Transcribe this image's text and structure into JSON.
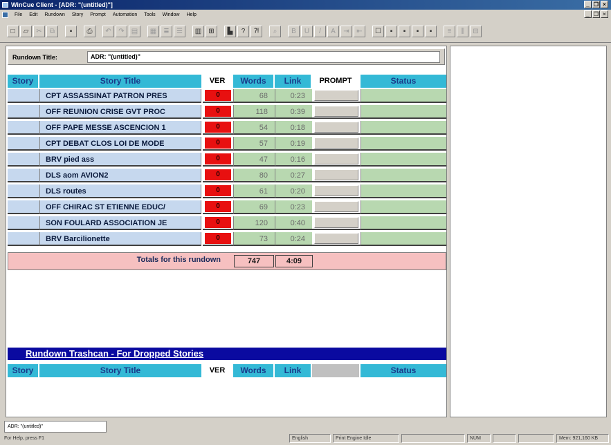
{
  "window": {
    "title": "WinCue Client - [ADR: \"(untitled)\"]"
  },
  "menu": [
    "File",
    "Edit",
    "Rundown",
    "Story",
    "Prompt",
    "Automation",
    "Tools",
    "Window",
    "Help"
  ],
  "rundown": {
    "title_label": "Rundown Title:",
    "title_value": "ADR: \"(untitled)\""
  },
  "columns": {
    "story": "Story",
    "title": "Story Title",
    "ver": "VER",
    "words": "Words",
    "link": "Link",
    "prompt": "PROMPT",
    "status": "Status"
  },
  "rows": [
    {
      "title": "CPT ASSASSINAT PATRON PRES",
      "ver": "0",
      "words": "68",
      "link": "0:23"
    },
    {
      "title": "OFF REUNION CRISE GVT PROC",
      "ver": "0",
      "words": "118",
      "link": "0:39"
    },
    {
      "title": "OFF PAPE MESSE ASCENCION 1",
      "ver": "0",
      "words": "54",
      "link": "0:18"
    },
    {
      "title": "CPT DEBAT CLOS LOI DE MODE",
      "ver": "0",
      "words": "57",
      "link": "0:19"
    },
    {
      "title": "BRV pied ass",
      "ver": "0",
      "words": "47",
      "link": "0:16"
    },
    {
      "title": "DLS aom        AVION2",
      "ver": "0",
      "words": "80",
      "link": "0:27"
    },
    {
      "title": "DLS routes",
      "ver": "0",
      "words": "61",
      "link": "0:20"
    },
    {
      "title": "OFF CHIRAC ST ETIENNE EDUC/",
      "ver": "0",
      "words": "69",
      "link": "0:23"
    },
    {
      "title": "SON FOULARD ASSOCIATION JE",
      "ver": "0",
      "words": "120",
      "link": "0:40"
    },
    {
      "title": "BRV Barcilionette",
      "ver": "0",
      "words": "73",
      "link": "0:24"
    }
  ],
  "totals": {
    "label": "Totals for this rundown",
    "words": "747",
    "link": "4:09"
  },
  "trashcan": {
    "title": "Rundown Trashcan - For Dropped Stories"
  },
  "statusbar": {
    "doc_tab": "ADR: \"(untitled)\"",
    "help": "For Help, press F1",
    "language": "English",
    "engine": "Print Engine Idle",
    "num": "NUM",
    "memo": "Mem: 921,160 KB"
  }
}
